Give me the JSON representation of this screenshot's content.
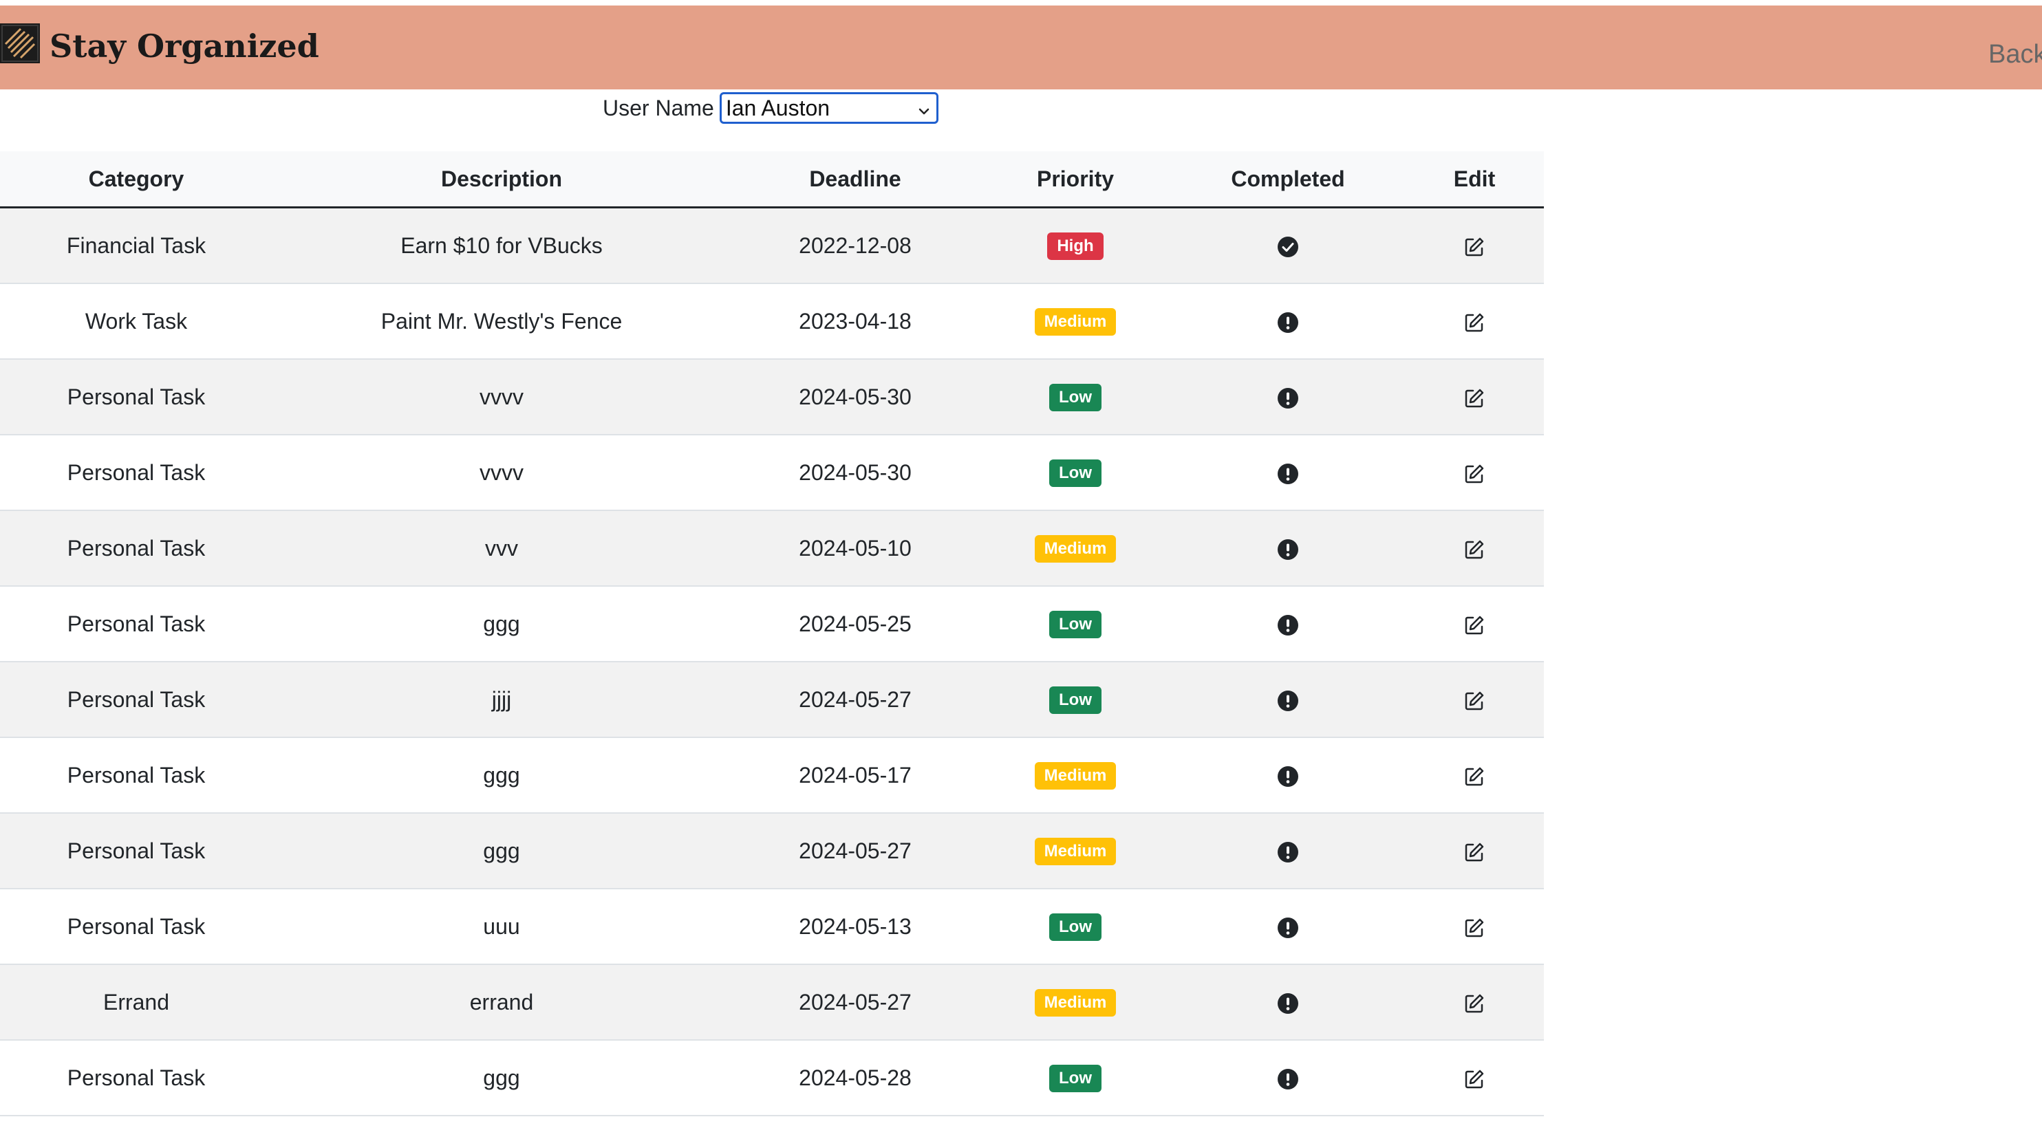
{
  "header": {
    "brand": "Stay Organized",
    "back_label": "Back"
  },
  "user": {
    "label": "User Name",
    "selected": "Ian Auston"
  },
  "table": {
    "columns": [
      "Category",
      "Description",
      "Deadline",
      "Priority",
      "Completed",
      "Edit"
    ],
    "rows": [
      {
        "category": "Financial Task",
        "description": "Earn $10 for VBucks",
        "deadline": "2022-12-08",
        "priority": "High",
        "completed": true
      },
      {
        "category": "Work Task",
        "description": "Paint Mr. Westly's Fence",
        "deadline": "2023-04-18",
        "priority": "Medium",
        "completed": false
      },
      {
        "category": "Personal Task",
        "description": "vvvv",
        "deadline": "2024-05-30",
        "priority": "Low",
        "completed": false
      },
      {
        "category": "Personal Task",
        "description": "vvvv",
        "deadline": "2024-05-30",
        "priority": "Low",
        "completed": false
      },
      {
        "category": "Personal Task",
        "description": "vvv",
        "deadline": "2024-05-10",
        "priority": "Medium",
        "completed": false
      },
      {
        "category": "Personal Task",
        "description": "ggg",
        "deadline": "2024-05-25",
        "priority": "Low",
        "completed": false
      },
      {
        "category": "Personal Task",
        "description": "jjjj",
        "deadline": "2024-05-27",
        "priority": "Low",
        "completed": false
      },
      {
        "category": "Personal Task",
        "description": "ggg",
        "deadline": "2024-05-17",
        "priority": "Medium",
        "completed": false
      },
      {
        "category": "Personal Task",
        "description": "ggg",
        "deadline": "2024-05-27",
        "priority": "Medium",
        "completed": false
      },
      {
        "category": "Personal Task",
        "description": "uuu",
        "deadline": "2024-05-13",
        "priority": "Low",
        "completed": false
      },
      {
        "category": "Errand",
        "description": "errand",
        "deadline": "2024-05-27",
        "priority": "Medium",
        "completed": false
      },
      {
        "category": "Personal Task",
        "description": "ggg",
        "deadline": "2024-05-28",
        "priority": "Low",
        "completed": false
      }
    ]
  },
  "icons": {
    "completed_true": "check-circle-icon",
    "completed_false": "exclamation-circle-icon",
    "edit": "pencil-square-icon",
    "logo": "stripes-logo-icon"
  },
  "colors": {
    "header_bg": "#e4a088",
    "priority_high": "#dc3545",
    "priority_medium": "#ffc107",
    "priority_low": "#198754"
  }
}
